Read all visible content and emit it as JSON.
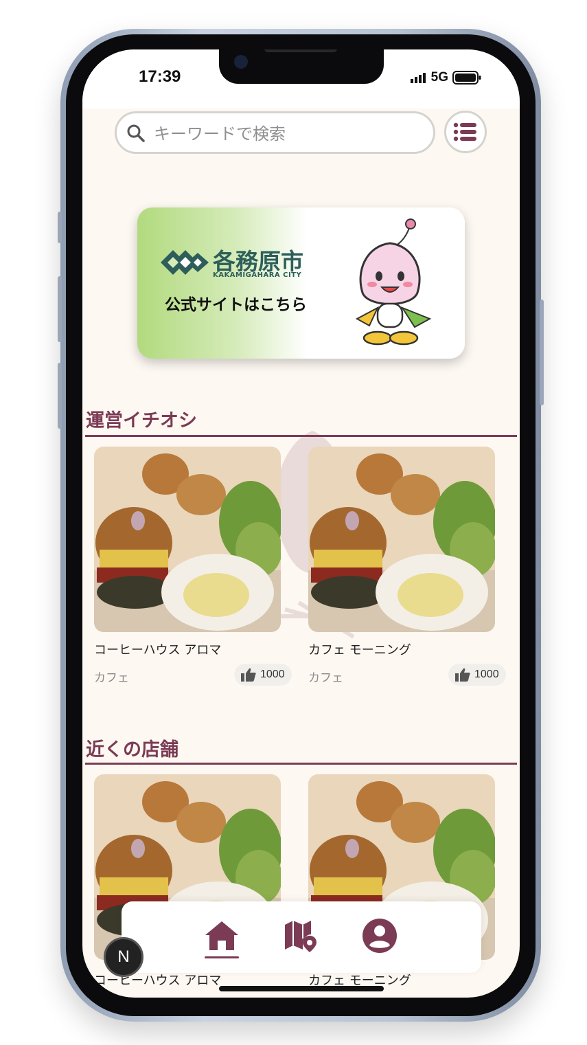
{
  "status_bar": {
    "time": "17:39",
    "network": "5G"
  },
  "search": {
    "placeholder": "キーワードで検索"
  },
  "banner": {
    "city_name": "各務原市",
    "city_name_en": "KAKAMIGAHARA CITY",
    "link_text": "公式サイトはこちら"
  },
  "sections": [
    {
      "title": "運営イチオシ",
      "cards": [
        {
          "name": "コーヒーハウス アロマ",
          "category": "カフェ",
          "likes": "1000"
        },
        {
          "name": "カフェ モーニング",
          "category": "カフェ",
          "likes": "1000"
        }
      ]
    },
    {
      "title": "近くの店舗",
      "cards": [
        {
          "name": "コーヒーハウス アロマ"
        },
        {
          "name": "カフェ モーニング"
        }
      ]
    }
  ],
  "bottom_nav": {
    "items": [
      {
        "icon": "home-icon",
        "active": true
      },
      {
        "icon": "map-pin-icon",
        "active": false
      },
      {
        "icon": "user-icon",
        "active": false
      }
    ]
  },
  "dev_badge": {
    "label": "N"
  },
  "colors": {
    "accent": "#7b3b55",
    "background": "#fdf8f2"
  }
}
